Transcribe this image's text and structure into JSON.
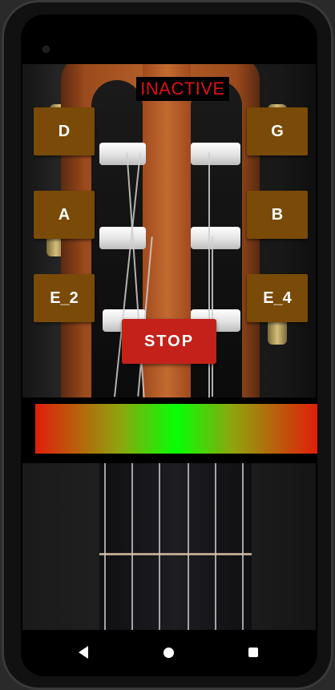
{
  "status": {
    "label": "INACTIVE",
    "color": "#e01010"
  },
  "strings": {
    "left": [
      {
        "label": "D"
      },
      {
        "label": "A"
      },
      {
        "label": "E_2"
      }
    ],
    "right": [
      {
        "label": "G"
      },
      {
        "label": "B"
      },
      {
        "label": "E_4"
      }
    ]
  },
  "controls": {
    "stop_label": "STOP"
  },
  "meter": {
    "colors": {
      "flat": "#e01e0a",
      "in_tune": "#06ff06",
      "sharp": "#e01e0a"
    }
  },
  "navbar": {
    "back": "back-icon",
    "home": "home-icon",
    "recents": "recents-icon"
  }
}
